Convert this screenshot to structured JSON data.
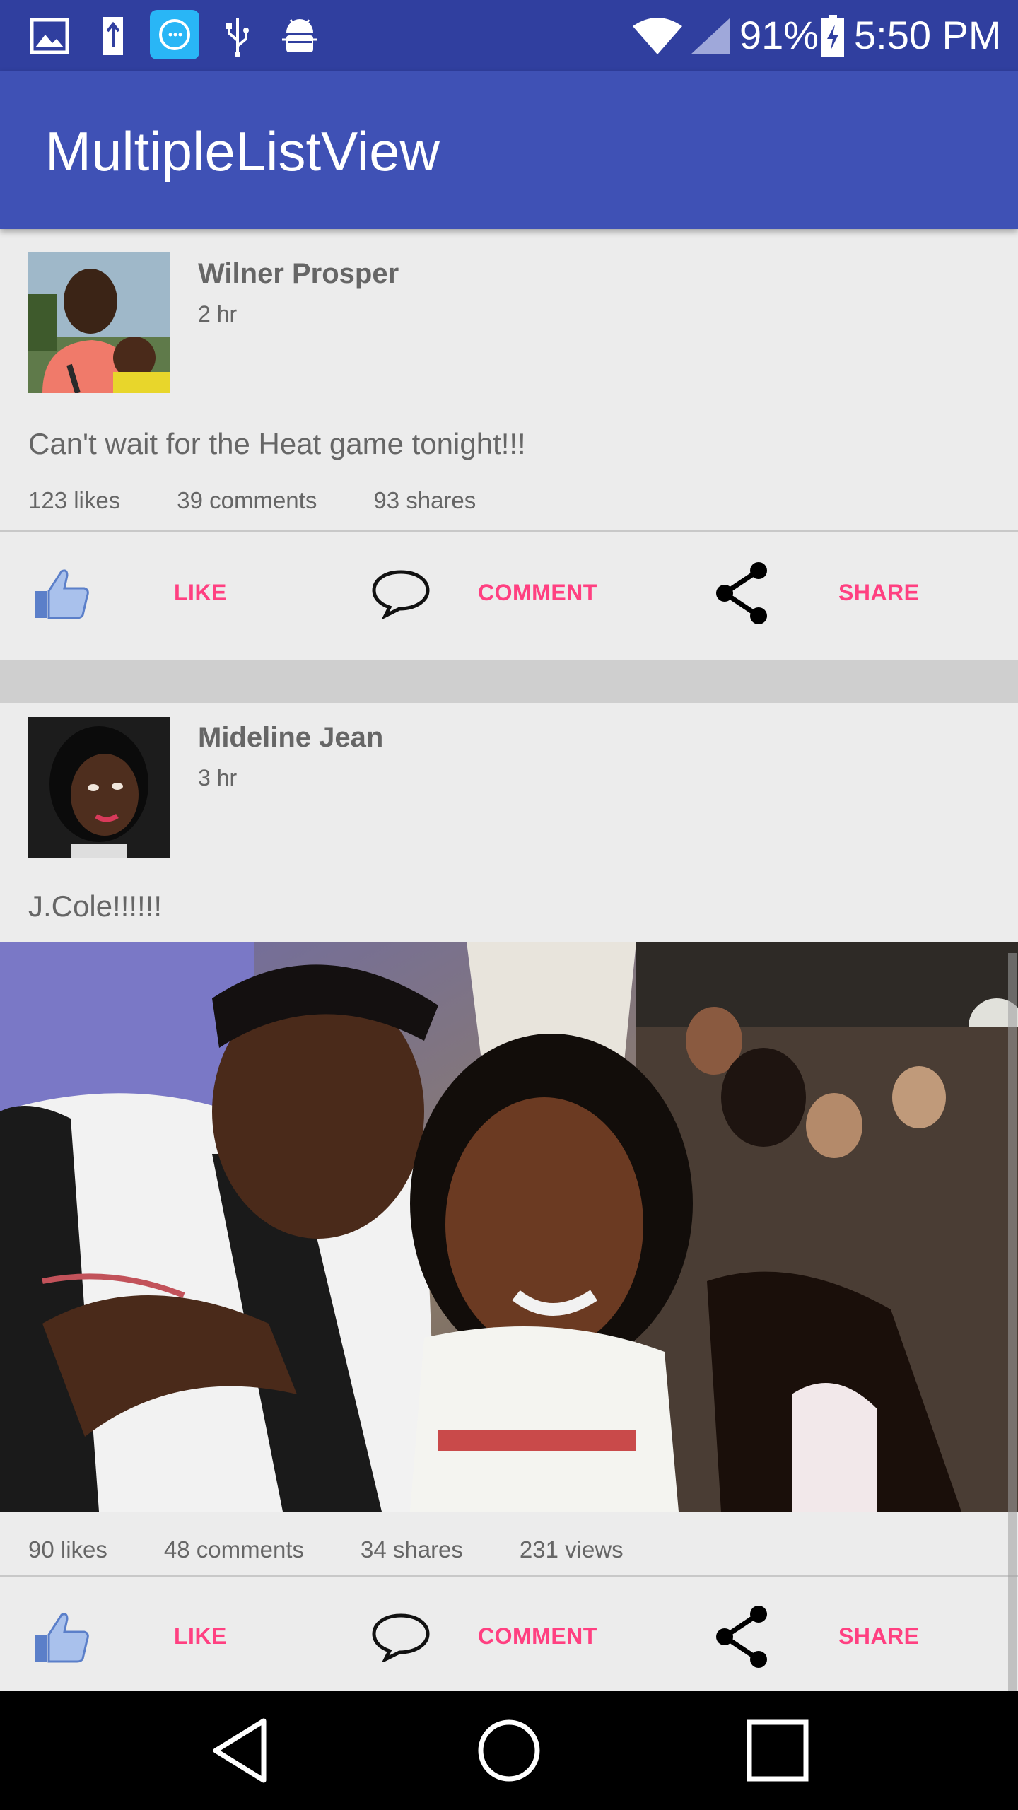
{
  "status_bar": {
    "battery": "91%",
    "time": "5:50 PM",
    "icons": [
      "gallery-icon",
      "sd-card-icon",
      "dialer-app-icon",
      "usb-icon",
      "android-debug-icon",
      "wifi-icon",
      "cell-signal-icon",
      "battery-charging-icon"
    ]
  },
  "app_bar": {
    "title": "MultipleListView"
  },
  "posts": [
    {
      "author": "Wilner Prosper",
      "time": "2 hr",
      "text": "Can't wait for the Heat game tonight!!!",
      "stats": {
        "likes": "123 likes",
        "comments": "39 comments",
        "shares": "93 shares"
      },
      "actions": {
        "like": "LIKE",
        "comment": "COMMENT",
        "share": "SHARE"
      }
    },
    {
      "author": "Mideline Jean",
      "time": "3 hr",
      "text": "J.Cole!!!!!!",
      "stats": {
        "likes": "90 likes",
        "comments": "48 comments",
        "shares": "34 shares",
        "views": "231 views"
      },
      "actions": {
        "like": "LIKE",
        "comment": "COMMENT",
        "share": "SHARE"
      }
    }
  ],
  "nav_bar": {
    "icons": [
      "back-icon",
      "home-icon",
      "recents-icon"
    ]
  },
  "colors": {
    "status_bar": "#303f9f",
    "app_bar": "#3f51b5",
    "accent": "#ff4081",
    "background": "#ececec"
  }
}
